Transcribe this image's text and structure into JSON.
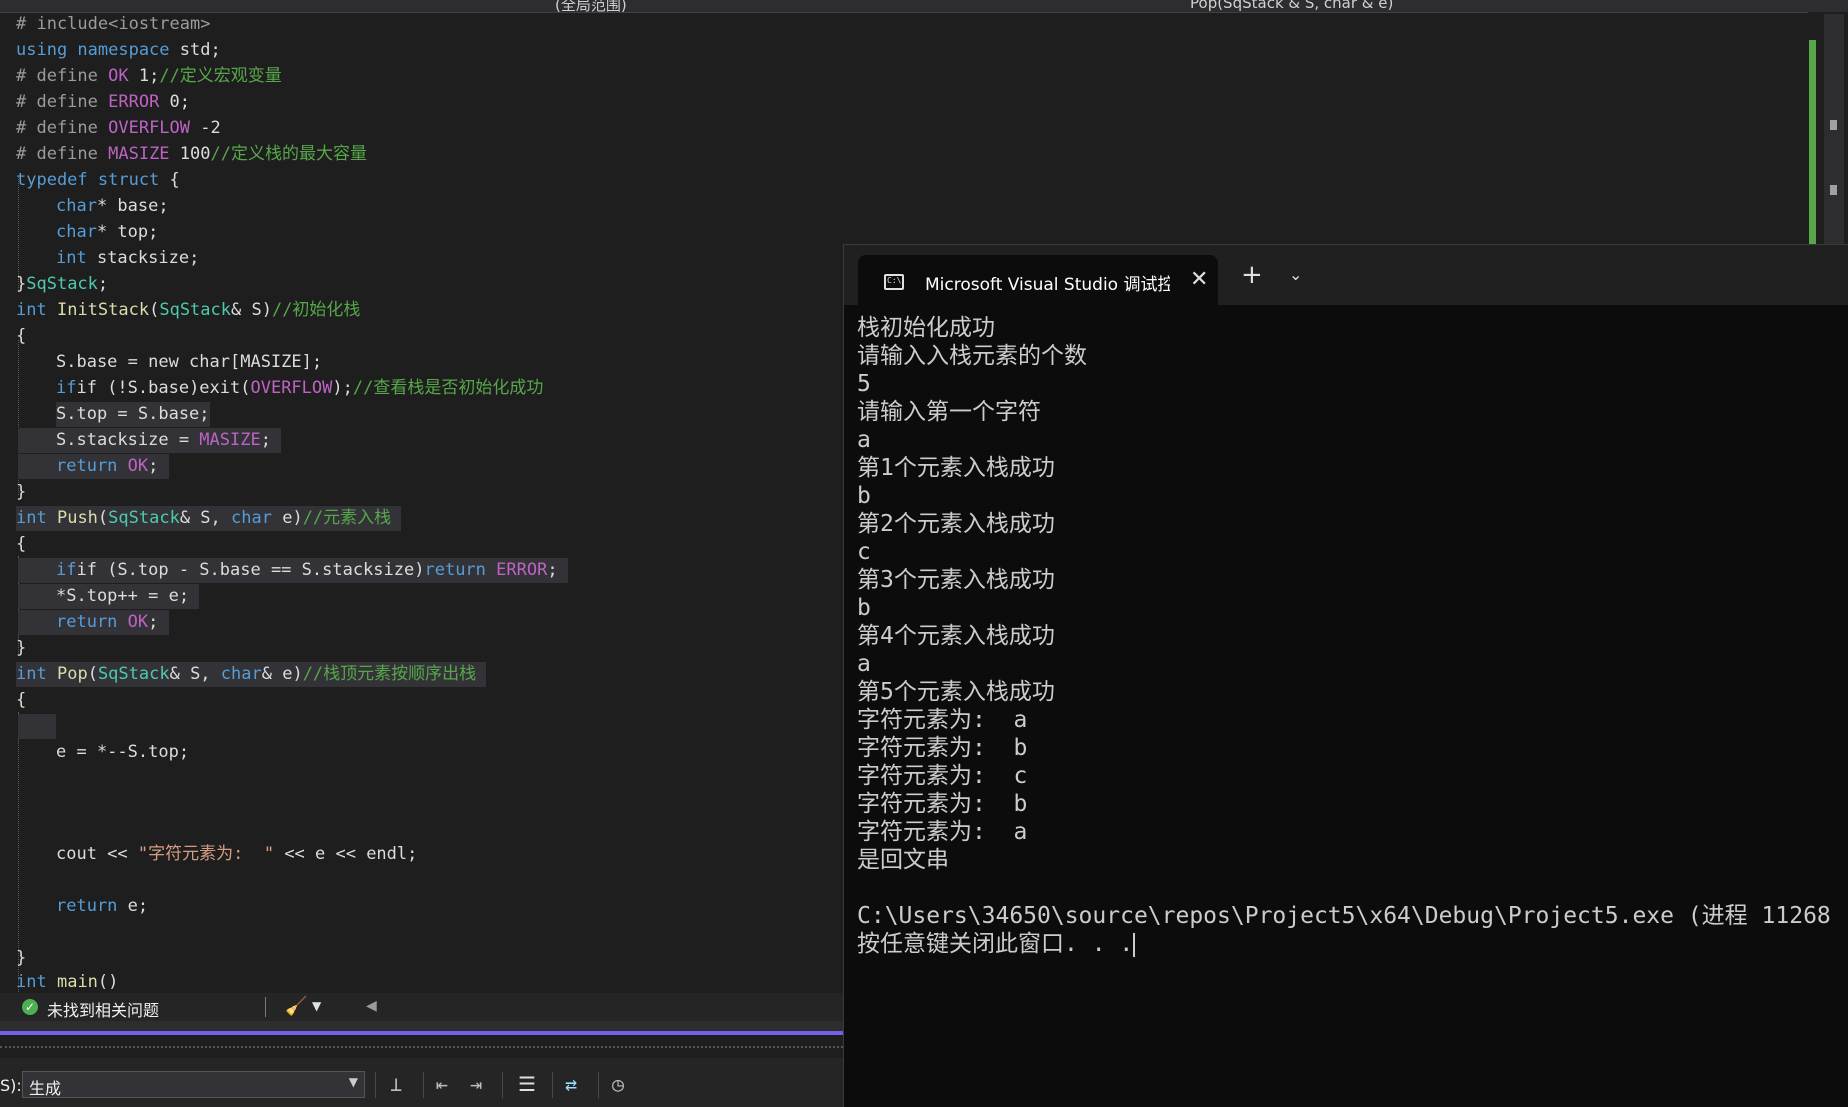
{
  "topbar": {
    "scope_dropdown": "(全局范围)",
    "function_dropdown": "Pop(SqStack & S, char & e)"
  },
  "code": {
    "line1": "# include<iostream>",
    "line2_kw": "using namespace",
    "line2_rest": " std;",
    "line3_pp": "# define ",
    "line3_macro": "OK",
    "line3_rest": " 1;",
    "line3_comment": "//定义宏观变量",
    "line4_pp": "# define ",
    "line4_macro": "ERROR",
    "line4_rest": " 0;",
    "line5_pp": "# define ",
    "line5_macro": "OVERFLOW",
    "line5_rest": " -2",
    "line6_pp": "# define ",
    "line6_macro": "MASIZE",
    "line6_rest": " 100",
    "line6_comment": "//定义栈的最大容量",
    "line7_kw": "typedef struct",
    "line7_rest": " {",
    "line8_kw": "char",
    "line8_rest": "* base;",
    "line9_kw": "char",
    "line9_rest": "* top;",
    "line10_kw": "int",
    "line10_rest": " stacksize;",
    "line11_brace": "}",
    "line11_type": "SqStack",
    "line11_rest": ";",
    "line12_kw": "int",
    "line12_fn": "InitStack",
    "line12_type": "SqStack",
    "line12_rest": "& S)",
    "line12_comment": "//初始化栈",
    "brace_open": "{",
    "brace_close": "}",
    "line14": "S.base = new char[MASIZE];",
    "line15_a": "if (!S.base)exit(",
    "line15_macro": "OVERFLOW",
    "line15_b": ");",
    "line15_comment": "//查看栈是否初始化成功",
    "line16": "S.top = S.base;",
    "line17_a": "S.stacksize = ",
    "line17_macro": "MASIZE",
    "line17_b": ";",
    "line18_kw": "return",
    "line18_macro": "OK",
    "line18_b": ";",
    "line20_kw": "int",
    "line20_fn": "Push",
    "line20_type": "SqStack",
    "line20_mid": "& S, ",
    "line20_kw2": "char",
    "line20_rest": " e)",
    "line20_comment": "//元素入栈",
    "line22_a": "if (S.top - S.base == S.stacksize)",
    "line22_kw": "return",
    "line22_macro": "ERROR",
    "line22_b": ";",
    "line23": "*S.top++ = e;",
    "line24_kw": "return",
    "line24_macro": "OK",
    "line24_b": ";",
    "line26_kw": "int",
    "line26_fn": "Pop",
    "line26_type": "SqStack",
    "line26_mid": "& S, ",
    "line26_kw2": "char",
    "line26_rest": "& e)",
    "line26_comment": "//栈顶元素按顺序出栈",
    "line29": "e = *--S.top;",
    "line33_a": "cout << ",
    "line33_str": "\"字符元素为:  \"",
    "line33_b": " << e << endl;",
    "line35_kw": "return",
    "line35_b": " e;",
    "line38_kw": "int",
    "line38_fn": "main",
    "line38_b": "()"
  },
  "status": {
    "issues_text": "未找到相关问题"
  },
  "output_panel": {
    "prefix": "S):",
    "source_selected": "生成"
  },
  "console": {
    "tab_title": "Microsoft Visual Studio 调试控制台",
    "lines": [
      "栈初始化成功",
      "请输入入栈元素的个数",
      "5",
      "请输入第一个字符",
      "a",
      "第1个元素入栈成功",
      "b",
      "第2个元素入栈成功",
      "c",
      "第3个元素入栈成功",
      "b",
      "第4个元素入栈成功",
      "a",
      "第5个元素入栈成功",
      "字符元素为:  a",
      "字符元素为:  b",
      "字符元素为:  c",
      "字符元素为:  b",
      "字符元素为:  a",
      "是回文串",
      "",
      "C:\\Users\\34650\\source\\repos\\Project5\\x64\\Debug\\Project5.exe (进程 11268",
      "按任意键关闭此窗口. . ."
    ]
  },
  "colors": {
    "keyword": "#569cd6",
    "type": "#4ec9b0",
    "macro": "#bd63c5",
    "comment": "#57a64a",
    "string": "#d69d85",
    "accent": "#7160e8"
  }
}
